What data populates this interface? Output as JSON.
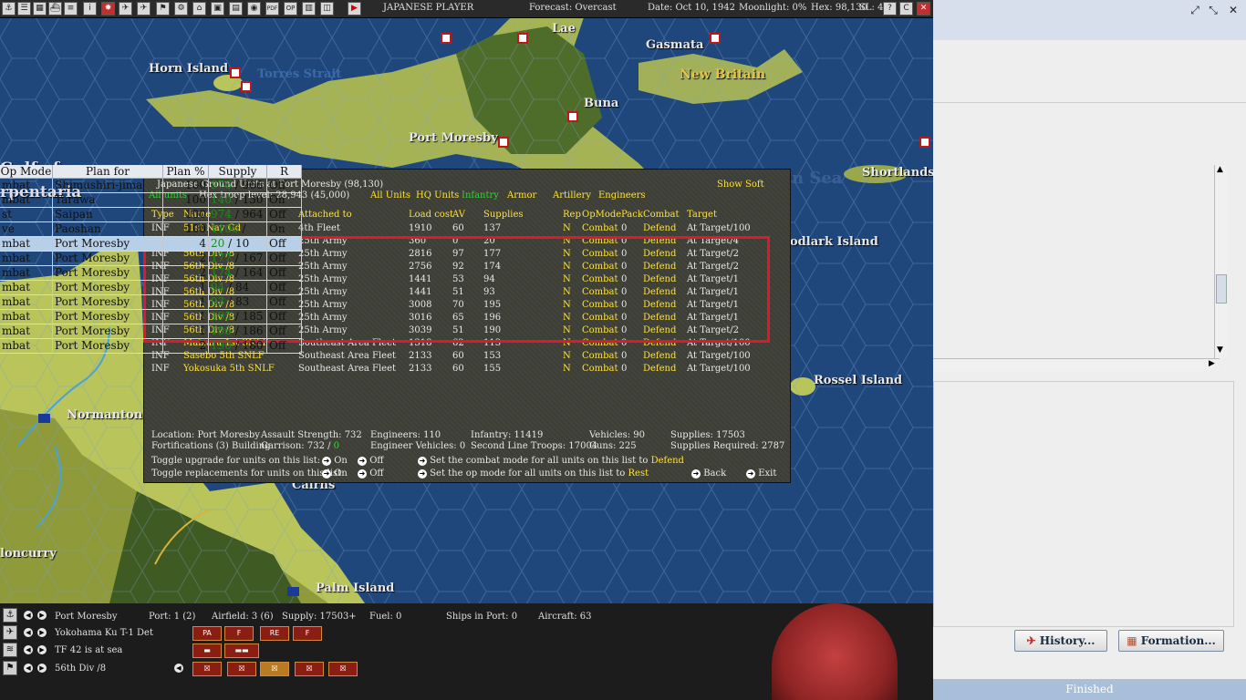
{
  "toolbar": {
    "player": "JAPANESE PLAYER",
    "forecast": "Forecast: Overcast",
    "date": "Date: Oct 10, 1942",
    "moonlight": "Moonlight: 0%",
    "hex": "Hex: 98,130",
    "sl": "SL: 4",
    "buttons": [
      "PDF",
      "OP"
    ]
  },
  "map": {
    "labels": {
      "lae": "Lae",
      "gasmata": "Gasmata",
      "horn_island": "Horn Island",
      "torres_strait": "Torres Strait",
      "new_britain": "New Britain",
      "buna": "Buna",
      "port_moresby": "Port Moresby",
      "gulf_of": "Gulf of",
      "carpentaria": "rpentaria",
      "shortlands": "Shortlands",
      "coral_sea": "n Sea",
      "woodlark": "odlark Island",
      "rossel": "Rossel Island",
      "normanton": "Normanton",
      "cairns": "Cairns",
      "cloncurry": "loncurry",
      "palm_island": "Palm Island"
    }
  },
  "dialog": {
    "title": "Japanese Ground Units at Port Moresby  (98,130)",
    "show_soft": "Show Soft",
    "all_units_tab": "All units",
    "hex_troop": "Hex troop level: 28,943  (45,000)",
    "filters": [
      "All Units",
      "HQ Units",
      "Infantry",
      "Armor",
      "Artillery",
      "Engineers"
    ],
    "headers": [
      "Type",
      "Name",
      "Attached to",
      "Load cost",
      "AV",
      "Supplies",
      "Rep",
      "OpMode",
      "Pack",
      "Combat",
      "Target"
    ],
    "rows": [
      {
        "type": "INF",
        "name": "51st Nav Gd",
        "attached": "4th Fleet",
        "load": "1910",
        "av": "60",
        "supplies": "137",
        "rep": "N",
        "opmode": "Combat",
        "pack": "0",
        "combat": "Defend",
        "target": "At Target/100"
      },
      {
        "type": "INF",
        "name": "56th Div",
        "attached": "25th Army",
        "load": "360",
        "av": "0",
        "supplies": "20",
        "rep": "N",
        "opmode": "Combat",
        "pack": "0",
        "combat": "Defend",
        "target": "At Target/4"
      },
      {
        "type": "INF",
        "name": "56th Div /8",
        "attached": "25th Army",
        "load": "2816",
        "av": "97",
        "supplies": "177",
        "rep": "N",
        "opmode": "Combat",
        "pack": "0",
        "combat": "Defend",
        "target": "At Target/2"
      },
      {
        "type": "INF",
        "name": "56th Div /8",
        "attached": "25th Army",
        "load": "2756",
        "av": "92",
        "supplies": "174",
        "rep": "N",
        "opmode": "Combat",
        "pack": "0",
        "combat": "Defend",
        "target": "At Target/2"
      },
      {
        "type": "INF",
        "name": "56th Div /8",
        "attached": "25th Army",
        "load": "1441",
        "av": "53",
        "supplies": "94",
        "rep": "N",
        "opmode": "Combat",
        "pack": "0",
        "combat": "Defend",
        "target": "At Target/1"
      },
      {
        "type": "INF",
        "name": "56th Div /8",
        "attached": "25th Army",
        "load": "1441",
        "av": "51",
        "supplies": "93",
        "rep": "N",
        "opmode": "Combat",
        "pack": "0",
        "combat": "Defend",
        "target": "At Target/1"
      },
      {
        "type": "INF",
        "name": "56th Div /8",
        "attached": "25th Army",
        "load": "3008",
        "av": "70",
        "supplies": "195",
        "rep": "N",
        "opmode": "Combat",
        "pack": "0",
        "combat": "Defend",
        "target": "At Target/1"
      },
      {
        "type": "INF",
        "name": "56th Div /8",
        "attached": "25th Army",
        "load": "3016",
        "av": "65",
        "supplies": "196",
        "rep": "N",
        "opmode": "Combat",
        "pack": "0",
        "combat": "Defend",
        "target": "At Target/1"
      },
      {
        "type": "INF",
        "name": "56th Div /8",
        "attached": "25th Army",
        "load": "3039",
        "av": "51",
        "supplies": "190",
        "rep": "N",
        "opmode": "Combat",
        "pack": "0",
        "combat": "Defend",
        "target": "At Target/2"
      },
      {
        "type": "INF",
        "name": "Maizuru 1st SNLF",
        "attached": "Southeast Area Fleet",
        "load": "1318",
        "av": "62",
        "supplies": "113",
        "rep": "N",
        "opmode": "Combat",
        "pack": "0",
        "combat": "Defend",
        "target": "At Target/100"
      },
      {
        "type": "INF",
        "name": "Sasebo 5th SNLF",
        "attached": "Southeast Area Fleet",
        "load": "2133",
        "av": "60",
        "supplies": "153",
        "rep": "N",
        "opmode": "Combat",
        "pack": "0",
        "combat": "Defend",
        "target": "At Target/100"
      },
      {
        "type": "INF",
        "name": "Yokosuka 5th SNLF",
        "attached": "Southeast Area Fleet",
        "load": "2133",
        "av": "60",
        "supplies": "155",
        "rep": "N",
        "opmode": "Combat",
        "pack": "0",
        "combat": "Defend",
        "target": "At Target/100"
      }
    ],
    "summary": {
      "location": "Location: Port Moresby",
      "fortifications": "Fortifications (3) Building",
      "assault": "Assault Strength: 732",
      "garrison": "Garrison: 732 /",
      "garrison_val": "0",
      "engineers": "Engineers: 110",
      "eng_vehicles": "Engineer Vehicles: 0",
      "infantry": "Infantry: 11419",
      "second_line": "Second Line Troops: 17004",
      "vehicles": "Vehicles: 90",
      "guns": "Guns: 225",
      "supplies": "Supplies: 17503",
      "supplies_req": "Supplies Required: 2787"
    },
    "toggles": {
      "upgrade": "Toggle upgrade for units on this list:",
      "replace": "Toggle replacements for units on this list:",
      "on": "On",
      "off": "Off",
      "combat_mode": "Set the combat mode for all units on this list to",
      "combat_val": "Defend",
      "op_mode": "Set the op mode for all units on this list to",
      "op_val": "Rest",
      "back": "Back",
      "exit": "Exit"
    }
  },
  "bottom": {
    "row1": {
      "name": "Port Moresby",
      "port": "Port: 1 (2)",
      "airfield": "Airfield: 3 (6)",
      "supply": "Supply: 17503+",
      "fuel": "Fuel: 0",
      "ships": "Ships in Port: 0",
      "aircraft": "Aircraft: 63"
    },
    "row2": {
      "name": "Yokohama Ku T-1 Det",
      "badges": [
        "PA",
        "F",
        "RE",
        "F"
      ]
    },
    "row3": {
      "name": "TF 42 is at sea"
    },
    "row4": {
      "name": "56th Div /8"
    }
  },
  "right": {
    "headers": [
      "Op Mode",
      "Plan for",
      "Plan %",
      "Supply",
      "R"
    ],
    "rows": [
      {
        "mode": "mbat",
        "plan": "Shimushiri-jima",
        "pct": "100",
        "sup_a": "976",
        "sup_b": " / 966",
        "r": "Off"
      },
      {
        "mode": "mbat",
        "plan": "Tarawa",
        "pct": "100",
        "sup_a": "140",
        "sup_b": " / 130",
        "r": "On"
      },
      {
        "mode": "st",
        "plan": "Saipan",
        "pct": "100",
        "sup_a": "974",
        "sup_b": " / 964",
        "r": "Off"
      },
      {
        "mode": "ve",
        "plan": "Paoshan",
        "pct": "100",
        "sup_a": "1106",
        "sup_b": " /",
        "r": "On"
      },
      {
        "mode": "mbat",
        "plan": "Port Moresby",
        "pct": "4",
        "sup_a": "20",
        "sup_b": " / 10",
        "r": "Off"
      },
      {
        "mode": "mbat",
        "plan": "Port Moresby",
        "pct": "2",
        "sup_a": "177",
        "sup_b": " / 167",
        "r": "Off"
      },
      {
        "mode": "mbat",
        "plan": "Port Moresby",
        "pct": "2",
        "sup_a": "174",
        "sup_b": " / 164",
        "r": "Off"
      },
      {
        "mode": "mbat",
        "plan": "Port Moresby",
        "pct": "1",
        "sup_a": "94",
        "sup_b": " / 84",
        "r": "Off"
      },
      {
        "mode": "mbat",
        "plan": "Port Moresby",
        "pct": "1",
        "sup_a": "93",
        "sup_b": " / 83",
        "r": "Off"
      },
      {
        "mode": "mbat",
        "plan": "Port Moresby",
        "pct": "1",
        "sup_a": "195",
        "sup_b": " / 185",
        "r": "Off"
      },
      {
        "mode": "mbat",
        "plan": "Port Moresby",
        "pct": "1",
        "sup_a": "196",
        "sup_b": " / 186",
        "r": "Off"
      },
      {
        "mode": "mbat",
        "plan": "Port Moresby",
        "pct": "2",
        "sup_a": "190",
        "sup_b": " / 180",
        "r": "Off"
      }
    ],
    "history_btn": "History...",
    "formation_btn": "Formation...",
    "status": "Finished"
  }
}
